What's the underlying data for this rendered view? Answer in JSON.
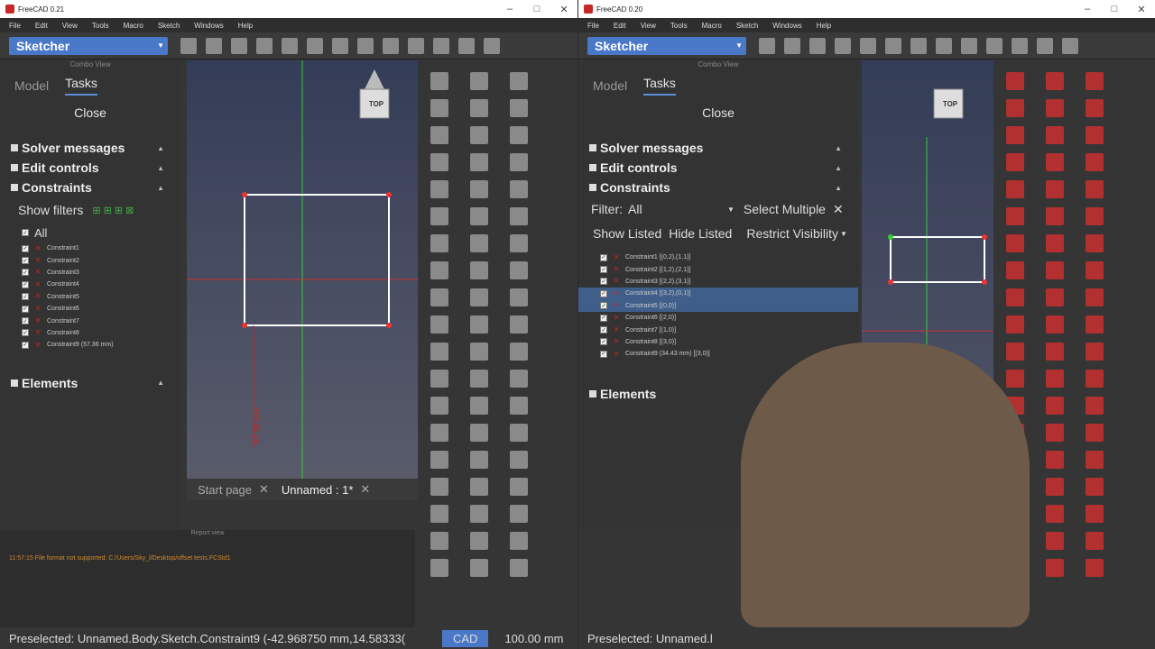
{
  "left": {
    "title": "FreeCAD 0.21",
    "menu": [
      "File",
      "Edit",
      "View",
      "Tools",
      "Macro",
      "Sketch",
      "Windows",
      "Help"
    ],
    "workbench": "Sketcher",
    "combo_title": "Combo View",
    "tabs": {
      "model": "Model",
      "tasks": "Tasks"
    },
    "close": "Close",
    "sections": {
      "solver": "Solver messages",
      "edit": "Edit controls",
      "constraints": "Constraints",
      "elements": "Elements"
    },
    "show_filters": "Show filters",
    "all": "All",
    "constraints": [
      "Constraint1",
      "Constraint2",
      "Constraint3",
      "Constraint4",
      "Constraint5",
      "Constraint6",
      "Constraint7",
      "Constraint8",
      "Constraint9 (57.36 mm)"
    ],
    "doc_tabs": {
      "start": "Start page",
      "unnamed": "Unnamed : 1*"
    },
    "report_title": "Report view",
    "report_line": "11:57:15  File format not supported: C:/Users/Sky_l/Desktop/offset tests.FCStd1",
    "navcube": "TOP",
    "dim_label": "57.36 mm",
    "status_text": "Preselected: Unnamed.Body.Sketch.Constraint9 (-42.968750 mm,14.58333(",
    "status_cad": "CAD",
    "status_size": "100.00 mm"
  },
  "right": {
    "title": "FreeCAD 0.20",
    "menu": [
      "File",
      "Edit",
      "View",
      "Tools",
      "Macro",
      "Sketch",
      "Windows",
      "Help"
    ],
    "workbench": "Sketcher",
    "combo_title": "Combo View",
    "tabs": {
      "model": "Model",
      "tasks": "Tasks"
    },
    "close": "Close",
    "sections": {
      "solver": "Solver messages",
      "edit": "Edit controls",
      "constraints": "Constraints",
      "elements": "Elements"
    },
    "filter_label": "Filter:",
    "filter_value": "All",
    "select_multiple": "Select Multiple",
    "show_listed": "Show Listed",
    "hide_listed": "Hide Listed",
    "restrict_visibility": "Restrict Visibility",
    "constraints": [
      "Constraint1 [(0,2),(1,1)]",
      "Constraint2 [(1,2),(2,1)]",
      "Constraint3 [(2,2),(3,1)]",
      "Constraint4 [(3,2),(0,1)]",
      "Constraint5 [(0,0)]",
      "Constraint6 [(2,0)]",
      "Constraint7 [(1,0)]",
      "Constraint8 [(3,0)]",
      "Constraint9 (34.43 mm) [(3,0)]"
    ],
    "navcube": "TOP",
    "status_text": "Preselected: Unnamed.l"
  }
}
